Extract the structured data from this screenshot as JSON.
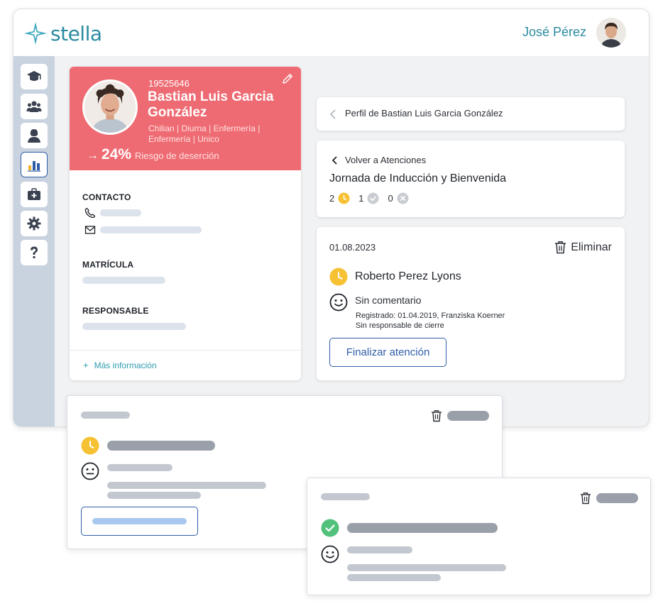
{
  "app": {
    "brand": "stella",
    "user_name": "José Pérez",
    "colors": {
      "brand": "#2c8ba1",
      "risk_header": "#ee6b73",
      "primary": "#2f5ea8",
      "link": "#2c9cb0"
    }
  },
  "sidebar": {
    "items": [
      {
        "icon": "graduation-cap-icon"
      },
      {
        "icon": "group-icon"
      },
      {
        "icon": "advisor-icon"
      },
      {
        "icon": "bar-chart-icon",
        "active": true
      },
      {
        "icon": "medical-kit-icon"
      },
      {
        "icon": "gear-icon"
      },
      {
        "icon": "help-icon"
      }
    ]
  },
  "profile": {
    "id": "19525646",
    "name": "Bastian Luis Garcia González",
    "meta": "Chilian | Diurna | Enfermería | Enfermería | Unico",
    "risk_arrow": "→",
    "risk_percent": "24%",
    "risk_label": "Riesgo de deserción",
    "sections": {
      "contact": "CONTACTO",
      "enrollment": "MATRÍCULA",
      "responsible": "RESPONSABLE"
    },
    "more_info": "Más información",
    "more_info_plus": "+"
  },
  "breadcrumb": {
    "text": "Perfil de Bastian Luis Garcia González"
  },
  "event": {
    "back_label": "Volver a Atenciones",
    "title": "Jornada de Inducción y Bienvenida",
    "counts": {
      "pending": "2",
      "done": "1",
      "cancelled": "0"
    }
  },
  "attention": {
    "date": "01.08.2023",
    "delete_label": "Eliminar",
    "person": "Roberto Perez Lyons",
    "comment": "Sin comentario",
    "registered": "Registrado: 01.04.2019, Franziska Koerner",
    "closure": "Sin responsable de cierre",
    "finish_label": "Finalizar atención"
  }
}
